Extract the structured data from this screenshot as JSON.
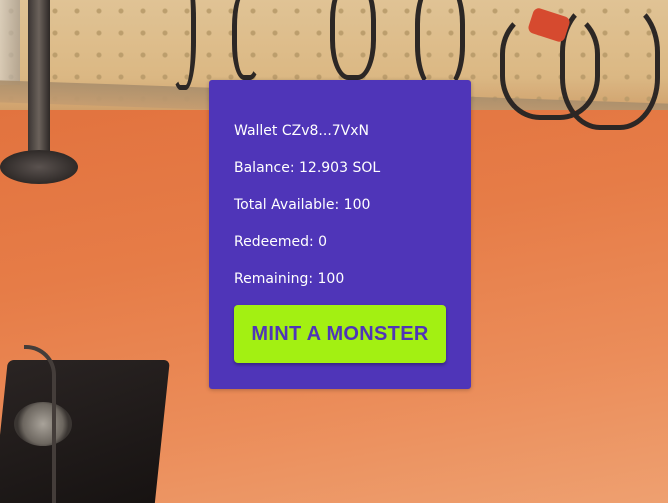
{
  "panel": {
    "wallet": "Wallet CZv8...7VxN",
    "balance": "Balance: 12.903 SOL",
    "total_available": "Total Available: 100",
    "redeemed": "Redeemed: 0",
    "remaining": "Remaining: 100",
    "mint_button_label": "MINT A MONSTER"
  },
  "colors": {
    "panel_background": "#4f35b8",
    "button_background": "#a3f012",
    "button_text": "#4f35b8",
    "text": "#ffffff"
  }
}
